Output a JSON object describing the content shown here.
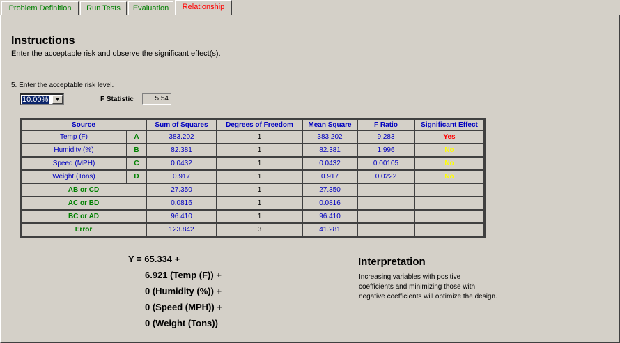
{
  "tabs": [
    {
      "label": "Problem Definition"
    },
    {
      "label": "Run Tests"
    },
    {
      "label": "Evaluation"
    },
    {
      "label": "Relationship"
    }
  ],
  "instructions": {
    "heading": "Instructions",
    "text": "Enter the acceptable risk and observe the significant effect(s)."
  },
  "risk": {
    "step_label": "5. Enter the acceptable risk level.",
    "selected": "10.00%",
    "f_statistic_label": "F Statistic",
    "f_statistic_value": "5.54"
  },
  "table": {
    "headers": [
      "Source",
      "Sum of Squares",
      "Degrees of Freedom",
      "Mean Square",
      "F Ratio",
      "Significant Effect"
    ],
    "factor_rows": [
      {
        "source": "Temp (F)",
        "letter": "A",
        "ss": "383.202",
        "df": "1",
        "ms": "383.202",
        "f": "9.283",
        "sig": "Yes"
      },
      {
        "source": "Humidity (%)",
        "letter": "B",
        "ss": "82.381",
        "df": "1",
        "ms": "82.381",
        "f": "1.996",
        "sig": "No"
      },
      {
        "source": "Speed (MPH)",
        "letter": "C",
        "ss": "0.0432",
        "df": "1",
        "ms": "0.0432",
        "f": "0.00105",
        "sig": "No"
      },
      {
        "source": "Weight (Tons)",
        "letter": "D",
        "ss": "0.917",
        "df": "1",
        "ms": "0.917",
        "f": "0.0222",
        "sig": "No"
      }
    ],
    "other_rows": [
      {
        "source": "AB or CD",
        "ss": "27.350",
        "df": "1",
        "ms": "27.350"
      },
      {
        "source": "AC or BD",
        "ss": "0.0816",
        "df": "1",
        "ms": "0.0816"
      },
      {
        "source": "BC or AD",
        "ss": "96.410",
        "df": "1",
        "ms": "96.410"
      },
      {
        "source": "Error",
        "ss": "123.842",
        "df": "3",
        "ms": "41.281"
      }
    ]
  },
  "equation": [
    "Y = 65.334 +",
    "6.921 (Temp (F)) +",
    "0 (Humidity (%)) +",
    "0 (Speed (MPH)) +",
    "0 (Weight (Tons))"
  ],
  "interpretation": {
    "heading": "Interpretation",
    "lines": [
      "Increasing variables with positive",
      "coefficients and minimizing those with",
      "negative coefficients will optimize the design."
    ]
  }
}
